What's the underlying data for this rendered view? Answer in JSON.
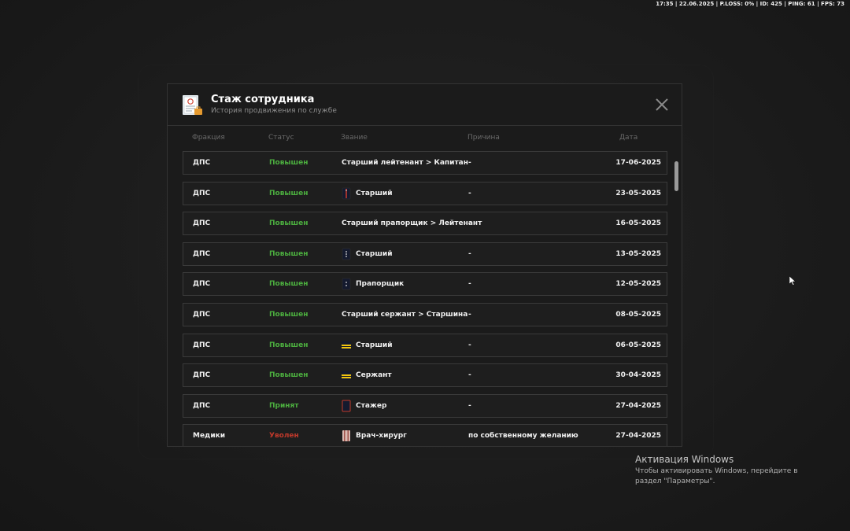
{
  "hud": {
    "text": "17:35 | 22.06.2025 | P.LOSS: 0% | ID: 425 | PING: 61 | FPS: 73"
  },
  "header": {
    "icon": "certificate-icon",
    "title": "Стаж сотрудника",
    "subtitle": "История продвижения по службе",
    "close_icon": "close-icon"
  },
  "columns": [
    "Фракция",
    "Статус",
    "Звание",
    "Причина",
    "Дата"
  ],
  "rows": [
    {
      "faction": "ДПС",
      "status": "Повышен",
      "status_color": "#4caf3f",
      "rank": "Старший лейтенант > Капитан",
      "rank_icon": "",
      "reason": "-",
      "date": "17-06-2025"
    },
    {
      "faction": "ДПС",
      "status": "Повышен",
      "status_color": "#4caf3f",
      "rank": "Старший",
      "rank_icon": "epaulette-red-stripe-icon",
      "reason": "-",
      "date": "23-05-2025"
    },
    {
      "faction": "ДПС",
      "status": "Повышен",
      "status_color": "#4caf3f",
      "rank": "Старший прапорщик > Лейтенант",
      "rank_icon": "",
      "reason": "-",
      "date": "16-05-2025"
    },
    {
      "faction": "ДПС",
      "status": "Повышен",
      "status_color": "#4caf3f",
      "rank": "Старший",
      "rank_icon": "epaulette-stars-icon",
      "reason": "-",
      "date": "13-05-2025"
    },
    {
      "faction": "ДПС",
      "status": "Повышен",
      "status_color": "#4caf3f",
      "rank": "Прапорщик",
      "rank_icon": "epaulette-stars-icon",
      "reason": "-",
      "date": "12-05-2025"
    },
    {
      "faction": "ДПС",
      "status": "Повышен",
      "status_color": "#4caf3f",
      "rank": "Старший сержант > Старшина",
      "rank_icon": "",
      "reason": "-",
      "date": "08-05-2025"
    },
    {
      "faction": "ДПС",
      "status": "Повышен",
      "status_color": "#4caf3f",
      "rank": "Старший",
      "rank_icon": "epaulette-yellow-stripes-icon",
      "reason": "-",
      "date": "06-05-2025"
    },
    {
      "faction": "ДПС",
      "status": "Повышен",
      "status_color": "#4caf3f",
      "rank": "Сержант",
      "rank_icon": "epaulette-yellow-stripes-icon",
      "reason": "-",
      "date": "30-04-2025"
    },
    {
      "faction": "ДПС",
      "status": "Принят",
      "status_color": "#4caf3f",
      "rank": "Стажер",
      "rank_icon": "epaulette-red-border-icon",
      "reason": "-",
      "date": "27-04-2025"
    },
    {
      "faction": "Медики",
      "status": "Уволен",
      "status_color": "#c0392b",
      "rank": "Врач-хирург",
      "rank_icon": "medic-epaulette-icon",
      "reason": "по собственному желанию",
      "date": "27-04-2025"
    }
  ],
  "windows_activation": {
    "title": "Активация Windows",
    "text": "Чтобы активировать Windows, перейдите в раздел \"Параметры\"."
  }
}
